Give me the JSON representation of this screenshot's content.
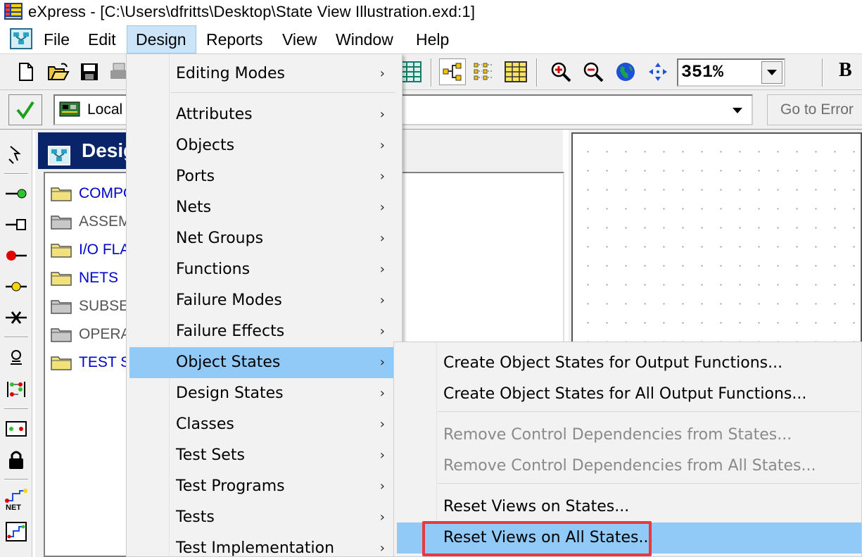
{
  "window": {
    "title": "eXpress - [C:\\Users\\dfritts\\Desktop\\State View Illustration.exd:1]",
    "app_icon": "express-app-icon"
  },
  "menubar": {
    "doc_icon": "document-window-icon",
    "items": [
      "File",
      "Edit",
      "Design",
      "Reports",
      "View",
      "Window",
      "Help"
    ],
    "active": "Design"
  },
  "toolbar": {
    "zoom_value": "351%",
    "bold_label": "B",
    "icons": [
      "new-file-icon",
      "open-folder-icon",
      "save-icon",
      "print-icon",
      "table-grid-icon",
      "hierarchy-icon",
      "dotted-list-icon",
      "yellow-grid-icon",
      "zoom-in-icon",
      "zoom-out-icon",
      "globe-icon",
      "fit-view-icon"
    ]
  },
  "scope_bar": {
    "check_icon": "green-check-icon",
    "scope_icon": "board-icon",
    "scope_value": "Local",
    "goto_error_label": "Go to Error"
  },
  "design_panel": {
    "caption": "Desig",
    "tree_items": [
      {
        "label": "COMPO",
        "style": "blue"
      },
      {
        "label": "ASSEM",
        "style": "gray"
      },
      {
        "label": "I/O FLA",
        "style": "blue"
      },
      {
        "label": "NETS",
        "style": "blue"
      },
      {
        "label": "SUBSE",
        "style": "gray"
      },
      {
        "label": "OPERA",
        "style": "gray"
      },
      {
        "label": "TEST S",
        "style": "blue"
      }
    ]
  },
  "design_menu": {
    "items": [
      {
        "label": "Editing Modes"
      },
      {
        "label": "Attributes"
      },
      {
        "label": "Objects"
      },
      {
        "label": "Ports"
      },
      {
        "label": "Nets"
      },
      {
        "label": "Net Groups"
      },
      {
        "label": "Functions"
      },
      {
        "label": "Failure Modes"
      },
      {
        "label": "Failure Effects"
      },
      {
        "label": "Object States"
      },
      {
        "label": "Design States"
      },
      {
        "label": "Classes"
      },
      {
        "label": "Test Sets"
      },
      {
        "label": "Test Programs"
      },
      {
        "label": "Tests"
      },
      {
        "label": "Test Implementation"
      }
    ],
    "highlighted": "Object States",
    "submenu_arrow": "›"
  },
  "object_states_submenu": {
    "items": [
      {
        "label": "Create Object States for Output Functions...",
        "enabled": true
      },
      {
        "label": "Create Object States for All Output Functions...",
        "enabled": true
      },
      {
        "label": "Remove Control Dependencies from States...",
        "enabled": false
      },
      {
        "label": "Remove Control Dependencies from All States...",
        "enabled": false
      },
      {
        "label": "Reset Views on States...",
        "enabled": true
      },
      {
        "label": "Reset Views on All States...",
        "enabled": true
      }
    ],
    "highlighted": "Reset Views on All States...",
    "annotation_color": "#e8393f"
  }
}
